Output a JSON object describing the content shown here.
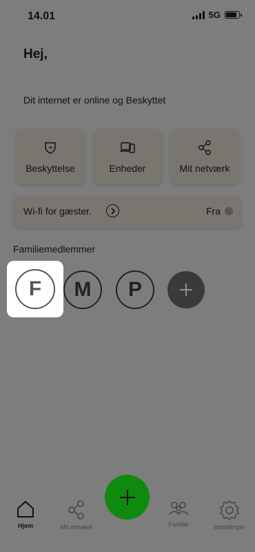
{
  "status_bar": {
    "time": "14.01",
    "network": "5G",
    "battery_level": 0.9
  },
  "greeting": "Hej,",
  "internet_status": "Dit internet er online og Beskyttet",
  "cards": [
    {
      "label": "Beskyttelse",
      "icon": "shield-icon"
    },
    {
      "label": "Enheder",
      "icon": "devices-icon"
    },
    {
      "label": "Mit netværk",
      "icon": "share-network-icon"
    }
  ],
  "guest_wifi": {
    "label": "Wi-fi for gæster.",
    "state": "Fra",
    "enabled": false
  },
  "family": {
    "heading": "Familiemedlemmer",
    "members": [
      {
        "initial": "F"
      },
      {
        "initial": "M"
      },
      {
        "initial": "P"
      }
    ],
    "add_icon": "plus-icon"
  },
  "bottom_nav": {
    "items": [
      {
        "label": "Hjem",
        "icon": "home-icon"
      },
      {
        "label": "Mit netværk",
        "icon": "share-network-icon"
      },
      {
        "label": "Familie",
        "icon": "family-icon"
      },
      {
        "label": "Indstillinger",
        "icon": "settings-icon"
      }
    ],
    "active": "Hjem"
  },
  "fab": {
    "icon": "plus-icon",
    "color": "#0f8a0f"
  }
}
